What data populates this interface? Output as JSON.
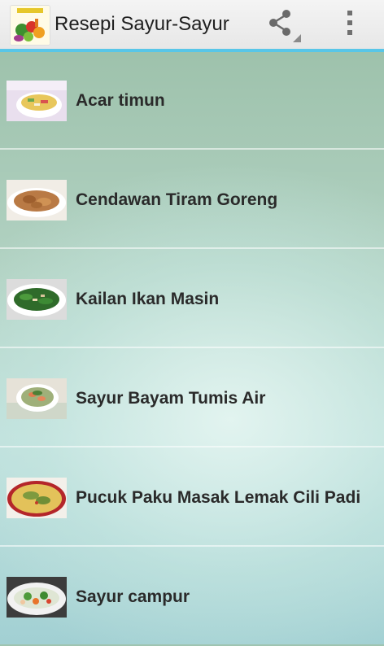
{
  "actionbar": {
    "title": "Resepi Sayur-Sayur",
    "share_icon": "share-icon",
    "overflow_icon": "overflow-menu-icon",
    "accent": "#58c6e8"
  },
  "recipes": [
    {
      "label": "Acar timun"
    },
    {
      "label": "Cendawan Tiram Goreng"
    },
    {
      "label": "Kailan Ikan Masin"
    },
    {
      "label": "Sayur Bayam Tumis Air"
    },
    {
      "label": "Pucuk Paku Masak Lemak Cili Padi"
    },
    {
      "label": "Sayur campur"
    }
  ]
}
